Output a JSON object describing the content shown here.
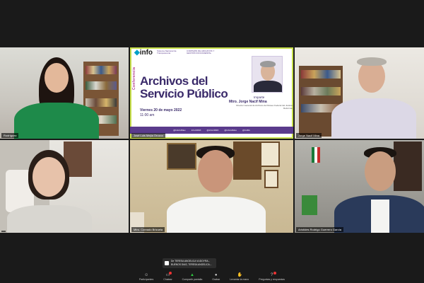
{
  "participants": [
    {
      "tile": "t1",
      "name": "Rodríguez"
    },
    {
      "tile": "t2",
      "name": "José Luis Mejía Orozco"
    },
    {
      "tile": "t3",
      "name": "Jorge Nacif Mina"
    },
    {
      "tile": "t4",
      "name": ""
    },
    {
      "tile": "t5",
      "name": "Mtro. Conrado Brizuela"
    },
    {
      "tile": "t6",
      "name": "Arístides Rodrigo Guerrero García"
    }
  ],
  "poster": {
    "logo": "info",
    "org_logo_1": "Sistema Nacional de Transparencia",
    "org_logo_2": "COMISIÓN DE ARCHIVOS Y GESTIÓN DOCUMENTAL",
    "vertical_label": "Conferencia",
    "title_line1": "Archivos del",
    "title_line2": "Servicio Público",
    "date": "Viernes 20 de mayo 2022",
    "time": "11:00 am",
    "imparte_label": "Imparte",
    "speaker": "Mtro. Jorge Nacif Mina",
    "speaker_role": "Director General de Archivos del Museo Federal del Justicia Reformas",
    "social": [
      "@InfoCdMex",
      "InfoCDMX",
      "@InfoCDMX",
      "@InfoCdMex",
      "@CdMx"
    ]
  },
  "chat_popup": {
    "line1": "De TERESA ANGELICA VUDOYRA...",
    "line2": "BUENOS DIAS, TERESA ANGELICA..."
  },
  "toolbar": {
    "items": [
      {
        "label": "Participantes",
        "icon": "users-icon"
      },
      {
        "label": "Chatear",
        "icon": "chat-icon"
      },
      {
        "label": "Compartir pantalla",
        "icon": "share-icon"
      },
      {
        "label": "Grabar",
        "icon": "record-icon"
      },
      {
        "label": "Levantar la mano",
        "icon": "hand-icon"
      },
      {
        "label": "Preguntas y respuestas",
        "icon": "qa-icon"
      }
    ]
  },
  "colors": {
    "accent_active": "#c8e04a",
    "poster_purple": "#5a3b8c",
    "share_green": "#2ecc40"
  }
}
